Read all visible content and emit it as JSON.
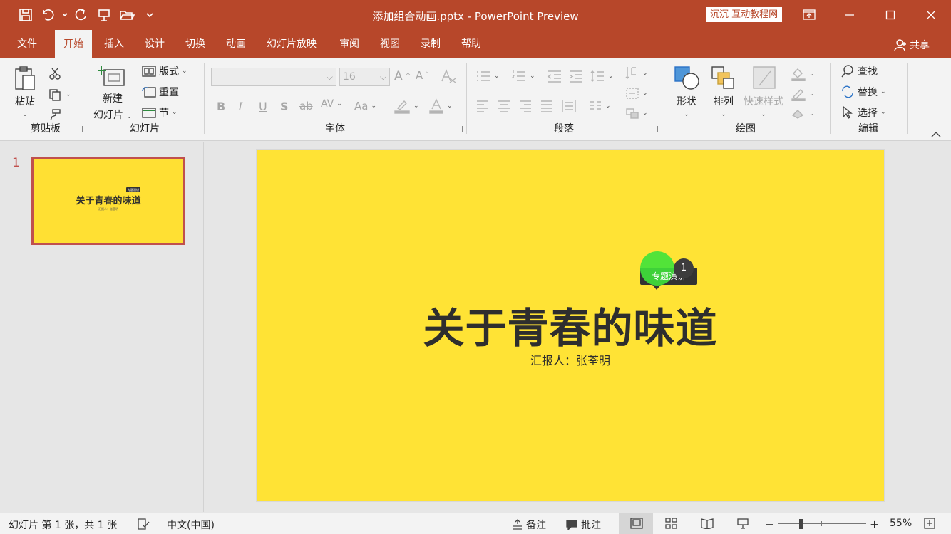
{
  "window": {
    "title": "添加组合动画.pptx  -  PowerPoint Preview",
    "brand": "互动教程网",
    "brand_prefix": "沉沉"
  },
  "tabs": [
    {
      "label": "文件",
      "active": false
    },
    {
      "label": "开始",
      "active": true
    },
    {
      "label": "插入",
      "active": false
    },
    {
      "label": "设计",
      "active": false
    },
    {
      "label": "切换",
      "active": false
    },
    {
      "label": "动画",
      "active": false
    },
    {
      "label": "幻灯片放映",
      "active": false
    },
    {
      "label": "审阅",
      "active": false
    },
    {
      "label": "视图",
      "active": false
    },
    {
      "label": "录制",
      "active": false
    },
    {
      "label": "帮助",
      "active": false
    }
  ],
  "share_label": "共享",
  "ribbon": {
    "clipboard": {
      "label": "剪贴板",
      "paste": "粘贴"
    },
    "slides": {
      "label": "幻灯片",
      "new_slide_1": "新建",
      "new_slide_2": "幻灯片",
      "layout": "版式",
      "reset": "重置",
      "section": "节"
    },
    "font": {
      "label": "字体",
      "font_name": "",
      "font_size": "16"
    },
    "paragraph": {
      "label": "段落"
    },
    "drawing": {
      "label": "绘图",
      "shapes": "形状",
      "arrange": "排列",
      "quick_styles": "快速样式"
    },
    "editing": {
      "label": "编辑",
      "find": "查找",
      "replace": "替换",
      "select": "选择"
    }
  },
  "thumbnail": {
    "number": "1",
    "title": "关于青春的味道",
    "subtitle": "汇报人：张荃明",
    "tag": "专题演讲"
  },
  "slide": {
    "title": "关于青春的味道",
    "subtitle": "汇报人：张荃明",
    "tag": "专题演讲",
    "animation_badge": "1",
    "background": "#ffe335"
  },
  "statusbar": {
    "slide_info": "幻灯片 第 1 张，共 1 张",
    "language": "中文(中国)",
    "notes": "备注",
    "comments": "批注",
    "zoom": "55%"
  },
  "colors": {
    "accent": "#b7472a",
    "selected_thumb_border": "#c0504d",
    "animation_dot": "#3fe23a"
  }
}
